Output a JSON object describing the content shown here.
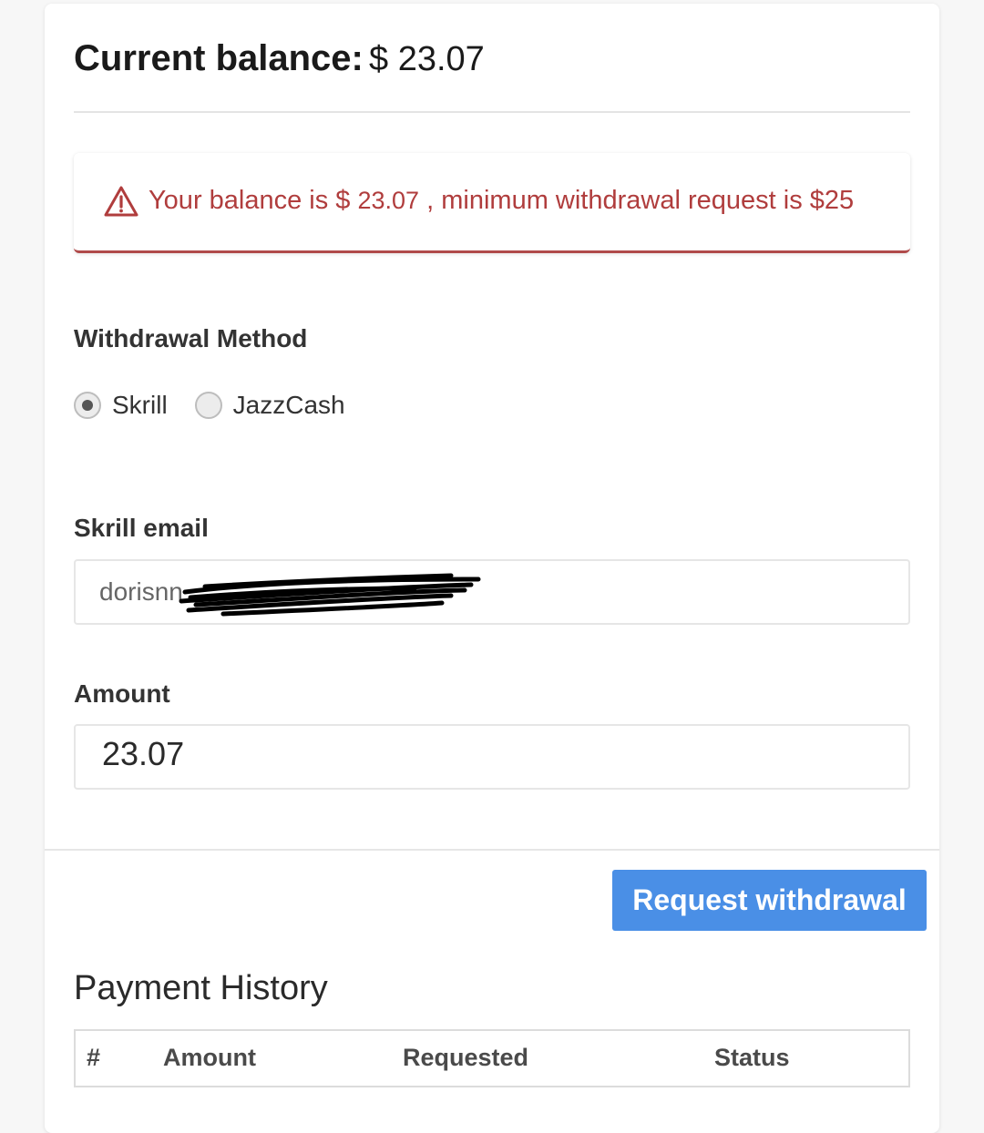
{
  "balance": {
    "title": "Current balance:",
    "value": "$ 23.07"
  },
  "alert": {
    "text_before": "Your balance is $ ",
    "amount": "23.07",
    "text_after": " , minimum withdrawal request is $25",
    "color": "#b03d3d"
  },
  "withdrawal": {
    "label": "Withdrawal Method",
    "options": [
      {
        "label": "Skrill",
        "selected": true
      },
      {
        "label": "JazzCash",
        "selected": false
      }
    ]
  },
  "email": {
    "label": "Skrill email",
    "value": "dorisnn"
  },
  "amount": {
    "label": "Amount",
    "value": "23.07"
  },
  "button": {
    "label": "Request withdrawal",
    "color": "#4a8fe6"
  },
  "history": {
    "title": "Payment History",
    "columns": [
      "#",
      "Amount",
      "Requested",
      "Status"
    ]
  }
}
